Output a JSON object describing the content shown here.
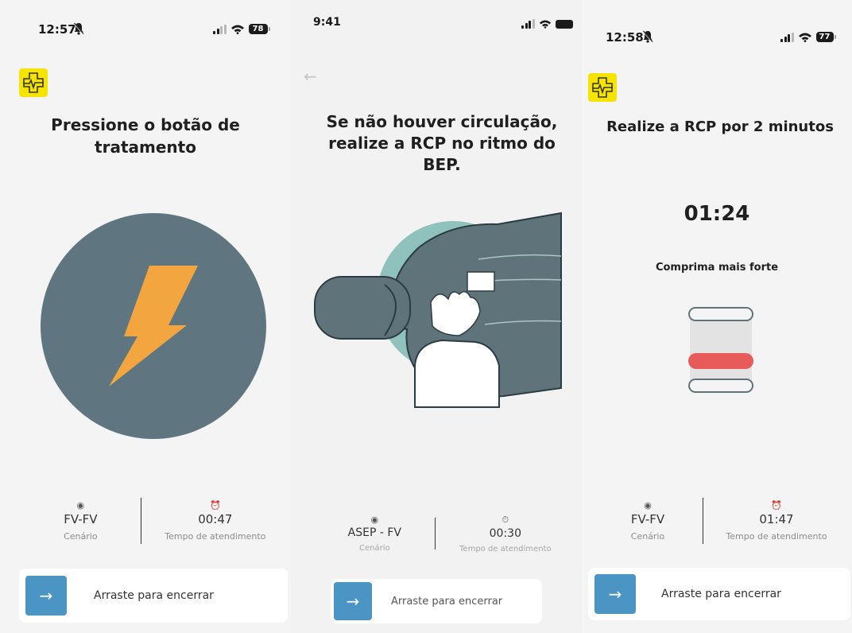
{
  "screens": [
    {
      "status": {
        "time": "12:57",
        "battery": "78"
      },
      "title": "Pressione o botão de tratamento",
      "info": {
        "scenario_value": "FV-FV",
        "scenario_label": "Cenário",
        "time_value": "00:47",
        "time_label": "Tempo de atendimento"
      },
      "slider_label": "Arraste para encerrar"
    },
    {
      "status": {
        "time": "9:41"
      },
      "title": "Se não houver circulação, realize a RCP no ritmo do BEP.",
      "info": {
        "scenario_value": "ASEP - FV",
        "scenario_label": "Cenário",
        "time_value": "00:30",
        "time_label": "Tempo de atendimento"
      },
      "slider_label": "Arraste para encerrar"
    },
    {
      "status": {
        "time": "12:58",
        "battery": "77"
      },
      "title": "Realize a RCP por 2 minutos",
      "timer": "01:24",
      "feedback": "Comprima mais forte",
      "info": {
        "scenario_value": "FV-FV",
        "scenario_label": "Cenário",
        "time_value": "01:47",
        "time_label": "Tempo de atendimento"
      },
      "slider_label": "Arraste para encerrar"
    }
  ],
  "colors": {
    "accent_blue": "#4a95c4",
    "logo_yellow": "#f6e400",
    "bolt_orange": "#f3a640",
    "circle_gray": "#5f7680",
    "alert_red": "#e85b5b",
    "body_slate": "#5f737b"
  },
  "icons": [
    "bell-off-icon",
    "signal-icon",
    "wifi-icon",
    "battery-icon",
    "logo-icon",
    "lightning-icon",
    "back-arrow-icon",
    "location-pin-icon",
    "alarm-clock-icon",
    "stopwatch-icon",
    "arrow-right-icon"
  ]
}
